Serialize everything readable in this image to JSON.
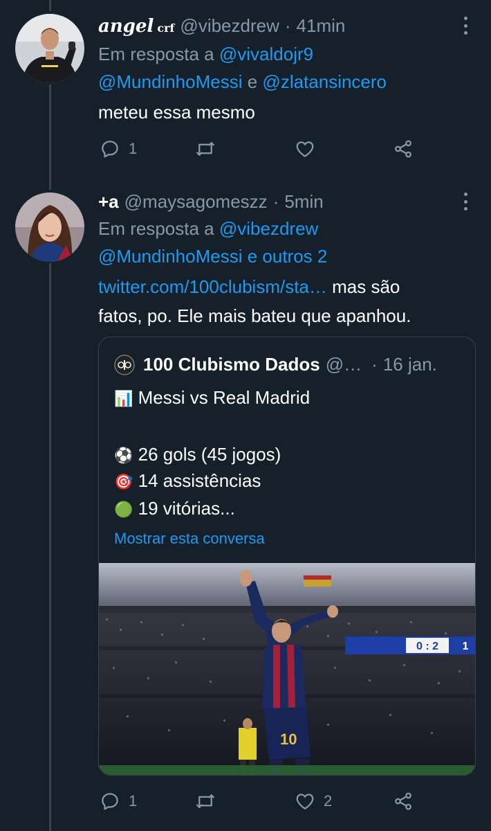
{
  "tweet1": {
    "name": "angel",
    "name_suffix": "crf",
    "handle": "@vibezdrew",
    "time": "41min",
    "reply_prefix": "Em resposta a",
    "reply_user1": "@vivaldojr9",
    "reply_user2": "@MundinhoMessi",
    "reply_and": "e",
    "reply_user3": "@zlatansincero",
    "text": "meteu essa mesmo",
    "reply_count": "1"
  },
  "tweet2": {
    "name": "+a",
    "handle": "@maysagomeszz",
    "time": "5min",
    "reply_prefix": "Em resposta a",
    "reply_user1": "@vibezdrew",
    "reply_user2": "@MundinhoMessi",
    "reply_others": "e outros 2",
    "link": "twitter.com/100clubism/sta…",
    "text_after_link": "mas são",
    "text_line2": "fatos, po. Ele mais bateu que apanhou.",
    "reply_count": "1",
    "like_count": "2"
  },
  "quote": {
    "name": "100 Clubismo Dados",
    "handle": "@…",
    "time": "16 jan.",
    "line1_emoji": "📊",
    "line1": "Messi vs Real Madrid",
    "line2_emoji": "⚽",
    "line2": "26 gols (45 jogos)",
    "line3_emoji": "🎯",
    "line3": "14 assistências",
    "line4_emoji": "🟢",
    "line4": "19 vitórias...",
    "show_thread": "Mostrar esta conversa",
    "photo_number": "10",
    "board_left": "0 : 2",
    "board_right": "1"
  },
  "colors": {
    "background": "#15202b",
    "link": "#1d9bf0",
    "secondary_text": "#8899a6",
    "border": "#38444d"
  },
  "icons": [
    "reply-icon",
    "retweet-icon",
    "like-icon",
    "share-icon",
    "more-icon"
  ]
}
